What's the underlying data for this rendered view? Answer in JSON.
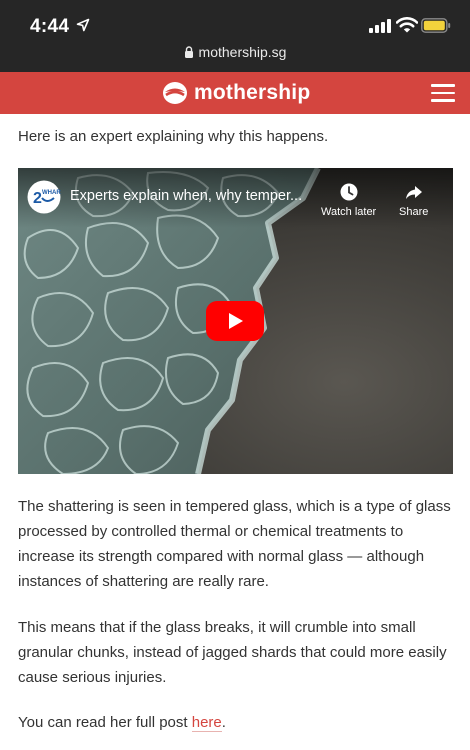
{
  "status_bar": {
    "time": "4:44",
    "url": "mothership.sg"
  },
  "header": {
    "brand": "mothership"
  },
  "article": {
    "intro": "Here is an expert explaining why this happens.",
    "paragraph_1": "The shattering is seen in tempered glass, which is a type of glass processed by controlled thermal or chemical treatments to increase its strength compared with normal glass — although instances of shattering are really rare.",
    "paragraph_2": "This means that if the glass breaks, it will crumble into small granular chunks, instead of jagged shards that could more easily cause serious injuries.",
    "paragraph_3_prefix": "You can read her full post ",
    "paragraph_3_link": "here",
    "paragraph_3_suffix": "."
  },
  "video": {
    "title": "Experts explain when, why temper...",
    "watch_later": "Watch later",
    "share": "Share",
    "channel_badge": "2 WHAR"
  },
  "colors": {
    "brand": "#d4453f",
    "status_bar": "#262626",
    "battery": "#f2d23c",
    "youtube_red": "#ff0000"
  }
}
